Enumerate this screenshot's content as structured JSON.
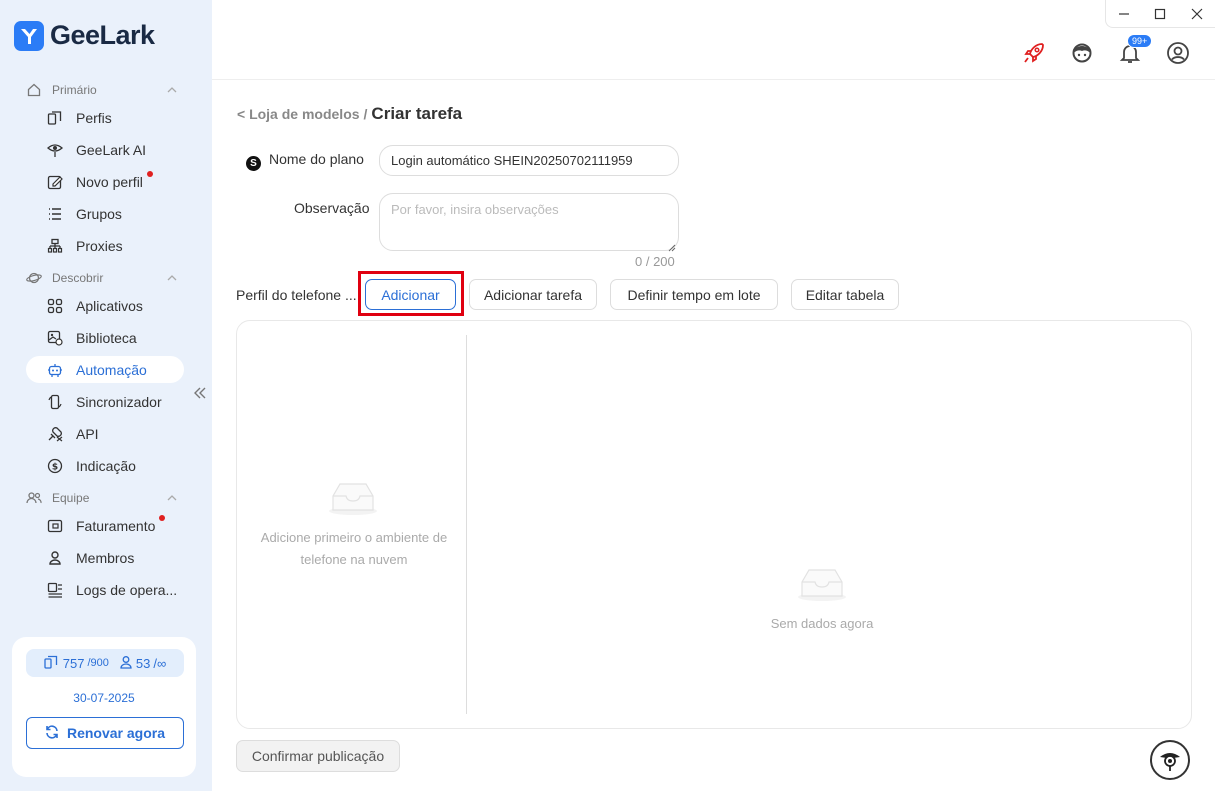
{
  "app": {
    "name": "GeeLark"
  },
  "sidebar": {
    "sections": [
      {
        "label": "Primário",
        "icon": "home-icon"
      },
      {
        "label": "Descobrir",
        "icon": "planet-icon"
      },
      {
        "label": "Equipe",
        "icon": "team-icon"
      }
    ],
    "items": [
      {
        "label": "Perfis",
        "icon": "profiles-icon"
      },
      {
        "label": "GeeLark AI",
        "icon": "ai-eye-icon"
      },
      {
        "label": "Novo perfil",
        "icon": "edit-icon"
      },
      {
        "label": "Grupos",
        "icon": "list-icon"
      },
      {
        "label": "Proxies",
        "icon": "proxy-icon"
      },
      {
        "label": "Aplicativos",
        "icon": "apps-icon"
      },
      {
        "label": "Biblioteca",
        "icon": "library-icon"
      },
      {
        "label": "Automação",
        "icon": "robot-icon"
      },
      {
        "label": "Sincronizador",
        "icon": "sync-icon"
      },
      {
        "label": "API",
        "icon": "api-icon"
      },
      {
        "label": "Indicação",
        "icon": "dollar-icon"
      },
      {
        "label": "Faturamento",
        "icon": "wallet-icon"
      },
      {
        "label": "Membros",
        "icon": "user-icon"
      },
      {
        "label": "Logs de opera...",
        "icon": "logs-icon"
      }
    ],
    "quota": {
      "phones_used": "757",
      "phones_total": "/900",
      "members_used": "53",
      "members_total": "/∞"
    },
    "expiry": "30-07-2025",
    "renew_label": "Renovar agora"
  },
  "topbar": {
    "notification_badge": "99+"
  },
  "page": {
    "breadcrumb_link": "< Loja de modelos",
    "breadcrumb_sep": "/",
    "breadcrumb_current": "Criar tarefa",
    "plan_badge": "S",
    "plan_label": "Nome do plano",
    "plan_value": "Login automático SHEIN20250702111959",
    "obs_label": "Observação",
    "obs_placeholder": "Por favor, insira observações",
    "obs_counter": "0 / 200",
    "phone_profile_label": "Perfil do telefone ...",
    "buttons": {
      "add": "Adicionar",
      "add_task": "Adicionar tarefa",
      "batch_time": "Definir tempo em lote",
      "edit_table": "Editar tabela"
    },
    "empty_left": [
      "Adicione primeiro o ambiente de",
      "telefone na nuvem"
    ],
    "empty_right": "Sem dados agora",
    "confirm_label": "Confirmar publicação"
  },
  "colors": {
    "accent": "#2b6fd6",
    "highlight": "#e00010",
    "sidebar_bg": "#eaf1fb"
  }
}
